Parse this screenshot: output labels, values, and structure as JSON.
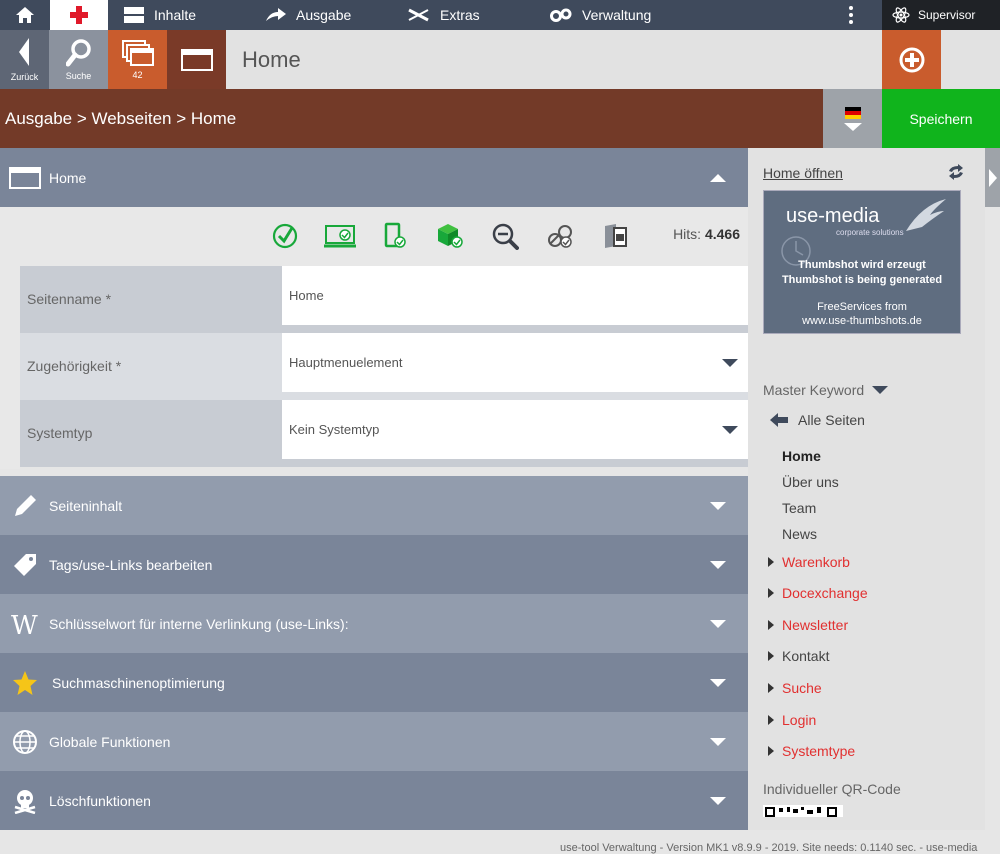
{
  "topnav": {
    "items": [
      {
        "label": "Inhalte",
        "icon": "content-icon"
      },
      {
        "label": "Ausgabe",
        "icon": "arrow-right-icon"
      },
      {
        "label": "Extras",
        "icon": "tools-icon"
      },
      {
        "label": "Verwaltung",
        "icon": "gears-icon"
      }
    ],
    "user": "Supervisor"
  },
  "toolbar": {
    "back_label": "Zurück",
    "search_label": "Suche",
    "pages_count": "42",
    "title": "Home"
  },
  "breadcrumb": {
    "text": "Ausgabe > Webseiten > Home",
    "save_label": "Speichern"
  },
  "main": {
    "home_panel": "Home",
    "hits_label": "Hits:",
    "hits_value": "4.466",
    "fields": [
      {
        "label": "Seitenname *",
        "value": "Home"
      },
      {
        "label": "Zugehörigkeit *",
        "value": "Hauptmenuelement"
      },
      {
        "label": "Systemtyp",
        "value": "Kein Systemtyp"
      }
    ],
    "panels": [
      "Seiteninhalt",
      "Tags/use-Links bearbeiten",
      "Schlüsselwort für interne Verlinkung (use-Links):",
      "Suchmaschinenoptimierung",
      "Globale Funktionen",
      "Löschfunktionen"
    ]
  },
  "sidebar": {
    "open_link": "Home öffnen",
    "thumb": {
      "brand": "use-media",
      "tagline": "corporate solutions",
      "line1": "Thumbshot wird erzeugt",
      "line2": "Thumbshot is being generated",
      "line3": "FreeServices from",
      "line4": "www.use-thumbshots.de"
    },
    "master_keyword": "Master Keyword",
    "all_pages": "Alle Seiten",
    "nav": [
      {
        "label": "Home"
      },
      {
        "label": "Über uns"
      },
      {
        "label": "Team"
      },
      {
        "label": "News"
      },
      {
        "label": "Warenkorb"
      },
      {
        "label": "Docexchange"
      },
      {
        "label": "Newsletter"
      },
      {
        "label": "Kontakt"
      },
      {
        "label": "Suche"
      },
      {
        "label": "Login"
      },
      {
        "label": "Systemtype"
      }
    ],
    "qr_label": "Individueller QR-Code"
  },
  "footer": "use-tool Verwaltung - Version MK1 v8.9.9 - 2019. Site needs: 0.1140 sec. - use-media",
  "colors": {
    "topnav": "#3f4a5c",
    "accent_orange": "#c95c2d",
    "brown": "#733a28",
    "save_green": "#10b41c",
    "panel": "#7a8599",
    "icon_green": "#18a83a",
    "link_red": "#e13030"
  }
}
